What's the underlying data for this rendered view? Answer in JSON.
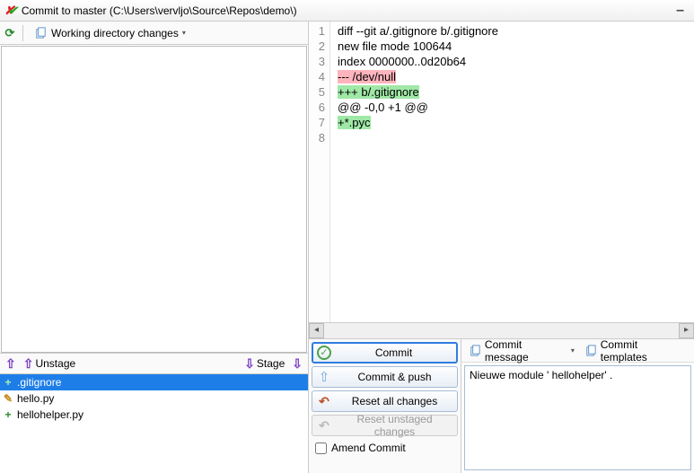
{
  "window": {
    "title": "Commit to master (C:\\Users\\vervljo\\Source\\Repos\\demo\\)"
  },
  "toolbar": {
    "working_dir_label": "Working directory changes"
  },
  "stage": {
    "unstage_label": "Unstage",
    "stage_label": "Stage"
  },
  "files": [
    {
      "name": ".gitignore",
      "status": "plus",
      "selected": true
    },
    {
      "name": "hello.py",
      "status": "pen",
      "selected": false
    },
    {
      "name": "hellohelper.py",
      "status": "plus",
      "selected": false
    }
  ],
  "diff": {
    "line_numbers": [
      "1",
      "2",
      "3",
      "4",
      "5",
      "6",
      "7",
      "8"
    ],
    "lines": [
      {
        "t": "diff --git a/.gitignore b/.gitignore",
        "c": "hd"
      },
      {
        "t": "new file mode 100644",
        "c": "hd"
      },
      {
        "t": "index 0000000..0d20b64",
        "c": "hd"
      },
      {
        "t": "--- /dev/null",
        "c": "del-i"
      },
      {
        "t": "+++ b/.gitignore",
        "c": "add-i"
      },
      {
        "t": "@@ -0,0 +1 @@",
        "c": "hunk"
      },
      {
        "t": "+*.pyc",
        "c": "add-i"
      },
      {
        "t": "",
        "c": ""
      }
    ]
  },
  "actions": {
    "commit": "Commit",
    "commit_push": "Commit & push",
    "reset_all": "Reset all changes",
    "reset_unstaged": "Reset unstaged changes",
    "amend": "Amend Commit"
  },
  "message_panel": {
    "commit_message_label": "Commit message",
    "commit_templates_label": "Commit templates",
    "message_value": "Nieuwe module ' hellohelper' ."
  }
}
